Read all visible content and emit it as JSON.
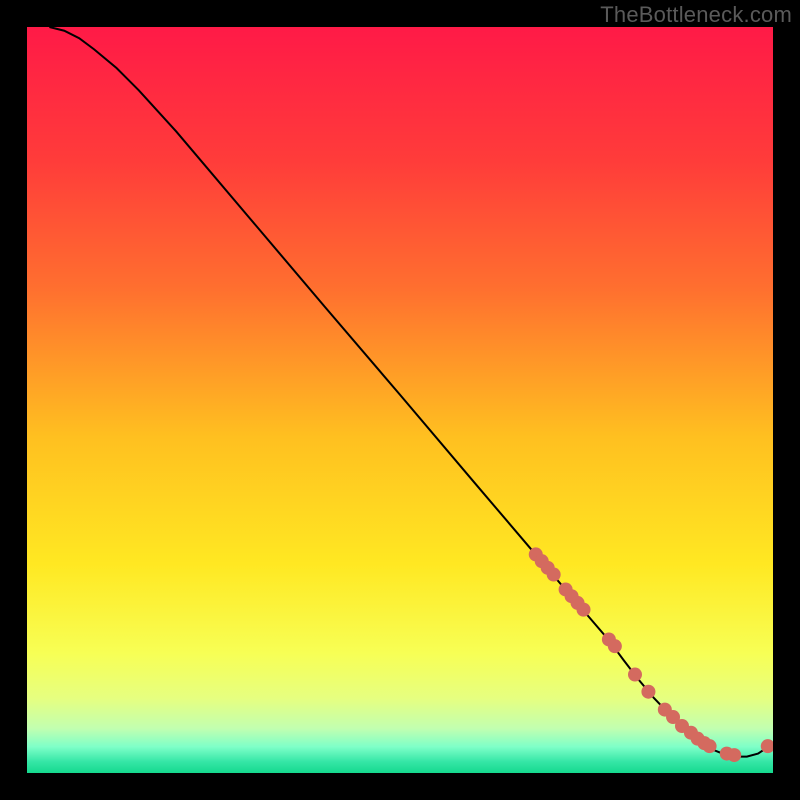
{
  "watermark": "TheBottleneck.com",
  "chart_data": {
    "type": "line",
    "title": "",
    "xlabel": "",
    "ylabel": "",
    "xlim": [
      0,
      100
    ],
    "ylim": [
      0,
      100
    ],
    "grid": false,
    "legend": false,
    "background_gradient_stops": [
      {
        "offset": 0.0,
        "color": "#ff1a47"
      },
      {
        "offset": 0.18,
        "color": "#ff3c3a"
      },
      {
        "offset": 0.35,
        "color": "#ff6f2f"
      },
      {
        "offset": 0.55,
        "color": "#ffc020"
      },
      {
        "offset": 0.72,
        "color": "#ffe822"
      },
      {
        "offset": 0.84,
        "color": "#f7ff55"
      },
      {
        "offset": 0.9,
        "color": "#e6ff80"
      },
      {
        "offset": 0.94,
        "color": "#c2ffb0"
      },
      {
        "offset": 0.965,
        "color": "#7effc8"
      },
      {
        "offset": 0.985,
        "color": "#35e6a6"
      },
      {
        "offset": 1.0,
        "color": "#15d98e"
      }
    ],
    "series": [
      {
        "name": "curve",
        "color": "#000000",
        "x": [
          3,
          5,
          7,
          9,
          12,
          15,
          20,
          30,
          40,
          50,
          60,
          68,
          72,
          75,
          78,
          80,
          82,
          84,
          86,
          88,
          90,
          92,
          93.5,
          95,
          96.5,
          98,
          99.5
        ],
        "y": [
          100,
          99.5,
          98.5,
          97,
          94.5,
          91.5,
          86,
          74.2,
          62.4,
          50.7,
          38.9,
          29.5,
          24.8,
          21.3,
          17.8,
          15.1,
          12.5,
          10.1,
          8.0,
          6.0,
          4.3,
          3.1,
          2.5,
          2.2,
          2.2,
          2.6,
          3.6
        ]
      }
    ],
    "markers": {
      "name": "highlight-dots",
      "color": "#d46a5f",
      "radius_px": 7,
      "x": [
        68.2,
        69.0,
        69.8,
        70.6,
        72.2,
        73.0,
        73.8,
        74.6,
        78.0,
        78.8,
        81.5,
        83.3,
        85.5,
        86.6,
        87.8,
        89.0,
        89.9,
        90.8,
        91.5,
        93.8,
        94.8,
        99.3
      ],
      "y": [
        29.3,
        28.4,
        27.5,
        26.6,
        24.6,
        23.7,
        22.8,
        21.9,
        17.9,
        17.0,
        13.2,
        10.9,
        8.5,
        7.5,
        6.3,
        5.4,
        4.6,
        4.0,
        3.6,
        2.6,
        2.4,
        3.6
      ]
    }
  }
}
